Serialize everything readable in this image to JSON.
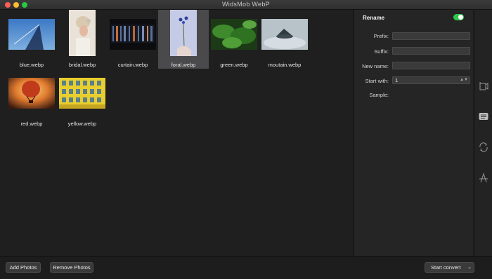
{
  "window": {
    "title": "WidsMob WebP"
  },
  "gallery": {
    "items": [
      {
        "name": "blue.webp",
        "selected": false
      },
      {
        "name": "bridal.webp",
        "selected": false
      },
      {
        "name": "curtain.webp",
        "selected": false
      },
      {
        "name": "foral.webp",
        "selected": true
      },
      {
        "name": "green.webp",
        "selected": false
      },
      {
        "name": "moutain.webp",
        "selected": false
      },
      {
        "name": "red.webp",
        "selected": false
      },
      {
        "name": "yellow.webp",
        "selected": false
      }
    ]
  },
  "rename": {
    "title": "Rename",
    "enabled": true,
    "prefix_label": "Prefix:",
    "prefix_value": "",
    "suffix_label": "Suffix:",
    "suffix_value": "",
    "newname_label": "New name:",
    "newname_value": "",
    "startwith_label": "Start with:",
    "startwith_value": "1",
    "sample_label": "Sample:",
    "sample_value": ""
  },
  "sidebar": {
    "icons": [
      "crop-icon",
      "rename-icon",
      "rotate-icon",
      "watermark-icon"
    ]
  },
  "footer": {
    "add_label": "Add Photos",
    "remove_label": "Remove Photos",
    "convert_label": "Start convert"
  },
  "colors": {
    "toggle_on": "#30c64b",
    "selection": "#4a4a4c"
  }
}
